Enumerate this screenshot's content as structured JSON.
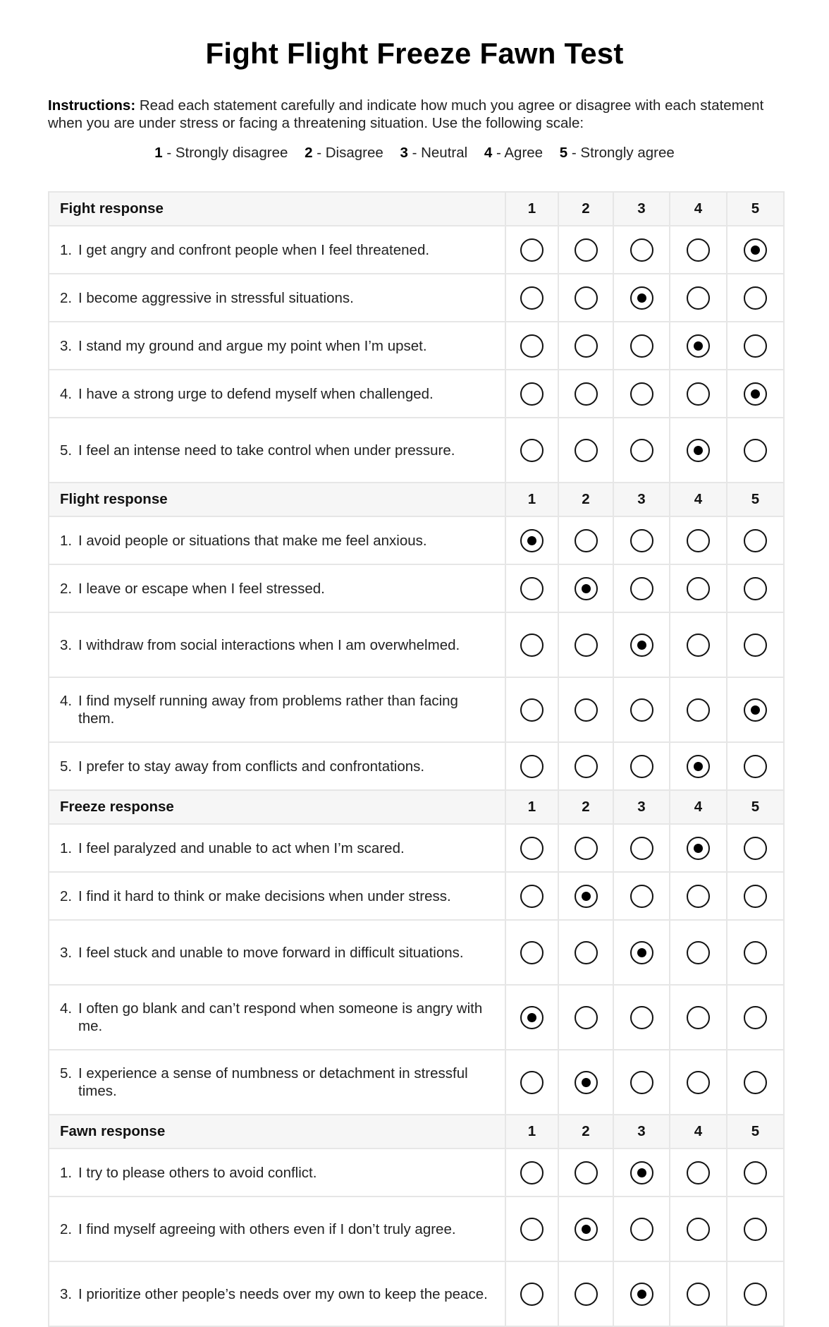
{
  "title": "Fight Flight Freeze Fawn Test",
  "instructions": {
    "label": "Instructions:",
    "text": " Read each statement carefully and indicate how much you agree or disagree with each statement when you are under stress or facing a threatening situation. Use the following scale:"
  },
  "scale": [
    {
      "value": "1",
      "label": " - Strongly disagree"
    },
    {
      "value": "2",
      "label": " - Disagree"
    },
    {
      "value": "3",
      "label": " - Neutral"
    },
    {
      "value": "4",
      "label": " - Agree"
    },
    {
      "value": "5",
      "label": " - Strongly agree"
    }
  ],
  "columns": [
    "1",
    "2",
    "3",
    "4",
    "5"
  ],
  "sections": [
    {
      "title": "Fight response",
      "items": [
        {
          "num": "1.",
          "text": "I get angry and confront people when I feel threatened.",
          "selected": 5
        },
        {
          "num": "2.",
          "text": "I become aggressive in stressful situations.",
          "selected": 3
        },
        {
          "num": "3.",
          "text": "I stand my ground and argue my point when I’m upset.",
          "selected": 4
        },
        {
          "num": "4.",
          "text": "I have a strong urge to defend myself when challenged.",
          "selected": 5
        },
        {
          "num": "5.",
          "text": "I feel an intense need to take control when under pressure.",
          "selected": 4
        }
      ]
    },
    {
      "title": "Flight response",
      "items": [
        {
          "num": "1.",
          "text": "I avoid people or situations that make me feel anxious.",
          "selected": 1
        },
        {
          "num": "2.",
          "text": "I leave or escape when I feel stressed.",
          "selected": 2
        },
        {
          "num": "3.",
          "text": "I withdraw from social interactions when I am overwhelmed.",
          "selected": 3
        },
        {
          "num": "4.",
          "text": "I find myself running away from problems rather than facing them.",
          "selected": 5
        },
        {
          "num": "5.",
          "text": "I prefer to stay away from conflicts and confrontations.",
          "selected": 4
        }
      ]
    },
    {
      "title": "Freeze response",
      "items": [
        {
          "num": "1.",
          "text": "I feel paralyzed and unable to act when I’m scared.",
          "selected": 4
        },
        {
          "num": "2.",
          "text": "I find it hard to think or make decisions when under stress.",
          "selected": 2
        },
        {
          "num": "3.",
          "text": "I feel stuck and unable to move forward in difficult situations.",
          "selected": 3
        },
        {
          "num": "4.",
          "text": "I often go blank and can’t respond when someone is angry with me.",
          "selected": 1
        },
        {
          "num": "5.",
          "text": "I experience a sense of numbness or detachment in stressful times.",
          "selected": 2
        }
      ]
    },
    {
      "title": "Fawn response",
      "items": [
        {
          "num": "1.",
          "text": "I try to please others to avoid conflict.",
          "selected": 3
        },
        {
          "num": "2.",
          "text": "I find myself agreeing with others even if I don’t truly agree.",
          "selected": 2
        },
        {
          "num": "3.",
          "text": "I prioritize other people’s needs over my own to keep the peace.",
          "selected": 3
        }
      ]
    }
  ]
}
